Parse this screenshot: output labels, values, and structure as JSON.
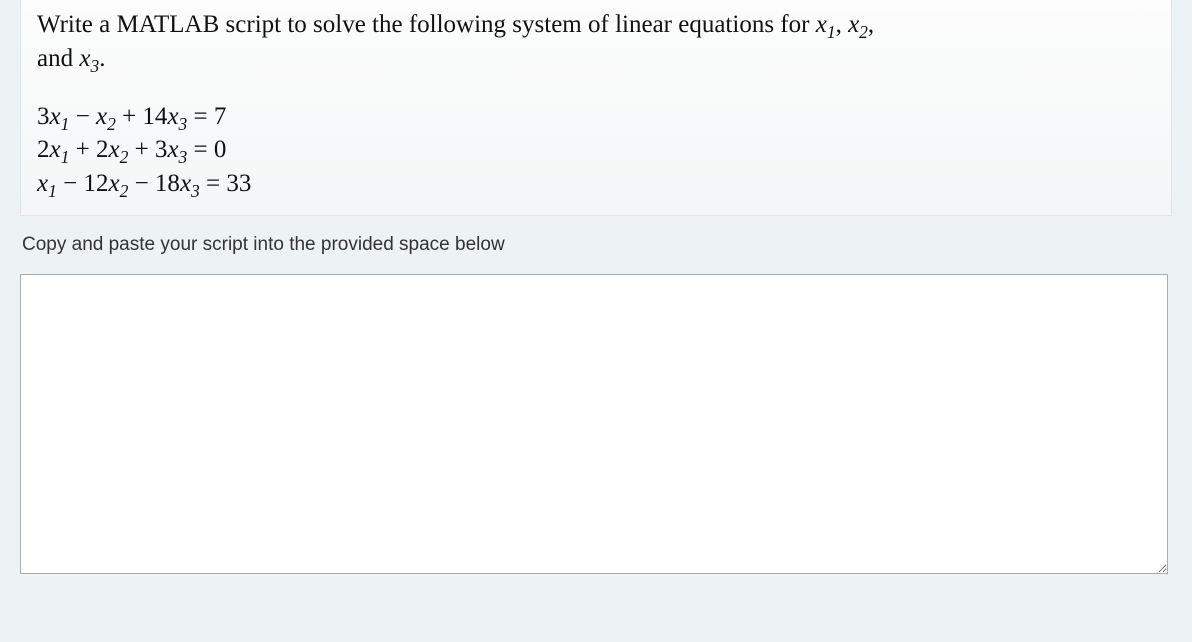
{
  "problem": {
    "lead_in_before_vars": "Write a MATLAB script to solve the following system of linear equations for ",
    "var1": "x",
    "var1_sub": "1",
    "comma1": ", ",
    "var2": "x",
    "var2_sub": "2",
    "comma2": ",",
    "line2_prefix": "and ",
    "var3": "x",
    "var3_sub": "3",
    "line2_suffix": "."
  },
  "equations": {
    "eq1": {
      "t1": "3",
      "v1": "x",
      "s1": "1",
      "t2": " − ",
      "v2": "x",
      "s2": "2",
      "t3": " + 14",
      "v3": "x",
      "s3": "3",
      "rhs": " = 7"
    },
    "eq2": {
      "t1": "2",
      "v1": "x",
      "s1": "1",
      "t2": " + 2",
      "v2": "x",
      "s2": "2",
      "t3": " + 3",
      "v3": "x",
      "s3": "3",
      "rhs": " = 0"
    },
    "eq3": {
      "t1": "",
      "v1": "x",
      "s1": "1",
      "t2": " − 12",
      "v2": "x",
      "s2": "2",
      "t3": " − 18",
      "v3": "x",
      "s3": "3",
      "rhs": " = 33"
    }
  },
  "instruction": "Copy and paste your script into the provided space below",
  "answer": {
    "value": "",
    "placeholder": ""
  }
}
